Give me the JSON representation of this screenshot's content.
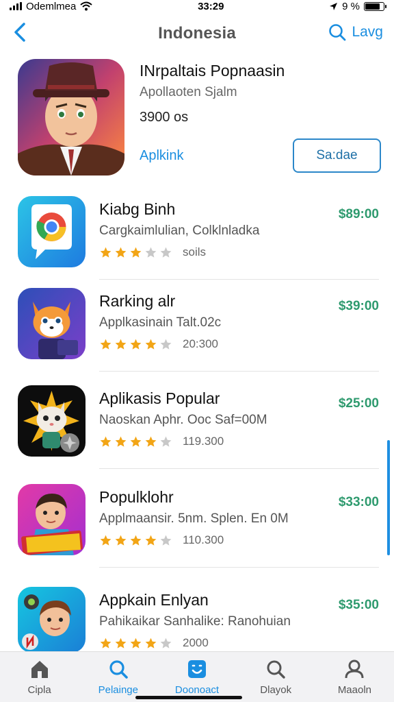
{
  "status": {
    "carrier": "Odemlmea",
    "time": "33:29",
    "battery": "9 %"
  },
  "nav": {
    "title": "Indonesia",
    "right_label": "Lavg"
  },
  "featured": {
    "title": "INrpaltais Popnaasin",
    "subtitle": "Apollaoten Sjalm",
    "price": "3900 os",
    "link": "Aplkink",
    "button": "Sa:dae"
  },
  "apps": [
    {
      "title": "Kiabg Binh",
      "subtitle": "Cargkaimlulian, Colklnladka",
      "rating": 3,
      "count": "soils",
      "price": "$89:00"
    },
    {
      "title": "Rarking alr",
      "subtitle": "Applkasinain Talt.02c",
      "rating": 4,
      "count": "20:300",
      "price": "$39:00"
    },
    {
      "title": "Aplikasis Popular",
      "subtitle": "Naoskan Aphr. Ooc Saf=00M",
      "rating": 4,
      "count": "119.300",
      "price": "$25:00"
    },
    {
      "title": "Populklohr",
      "subtitle": "Applmaansir. 5nm. Splen. En 0M",
      "rating": 4,
      "count": "110.300",
      "price": "$33:00"
    },
    {
      "title": "Appkain Enlyan",
      "subtitle": "Pahikaikar Sanhalike: Ranohuian",
      "rating": 4,
      "count": "2000",
      "price": "$35:00"
    }
  ],
  "tabs": [
    {
      "label": "Cipla",
      "icon": "home-icon"
    },
    {
      "label": "Pelainge",
      "icon": "search-icon"
    },
    {
      "label": "Doonoact",
      "icon": "apps-icon"
    },
    {
      "label": "Dlayok",
      "icon": "search-outline-icon"
    },
    {
      "label": "Maaoln",
      "icon": "person-icon"
    }
  ],
  "colors": {
    "accent": "#1a8ee0",
    "price": "#2e9a6e",
    "star": "#f2a516"
  }
}
